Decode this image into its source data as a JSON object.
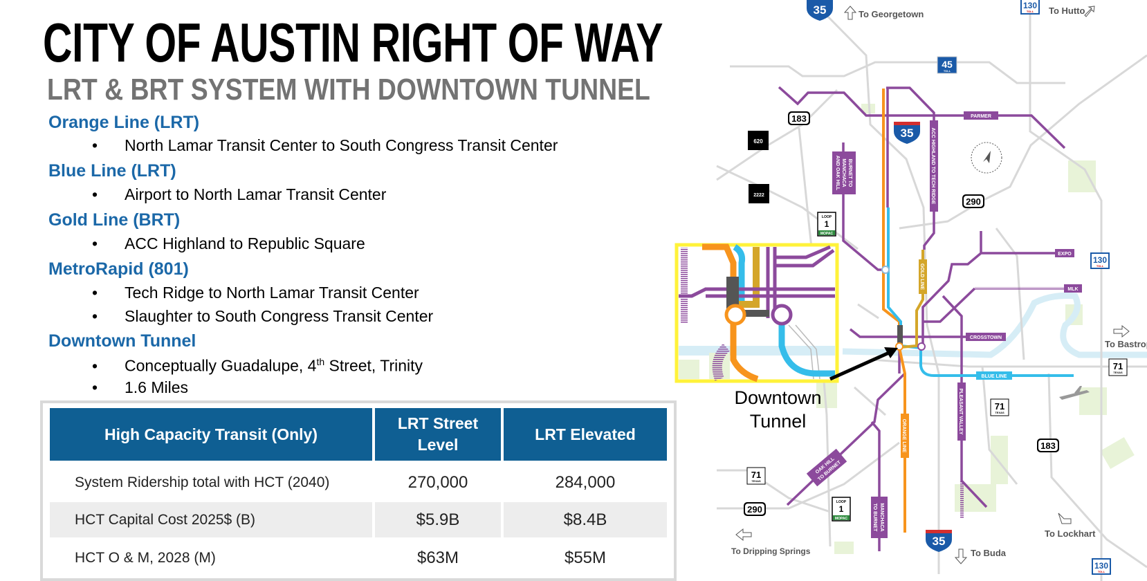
{
  "title": "CITY OF AUSTIN RIGHT OF WAY",
  "subtitle": "LRT & BRT SYSTEM WITH DOWNTOWN TUNNEL",
  "sections": [
    {
      "heading": "Orange Line (LRT)",
      "bullets": [
        "North Lamar Transit Center to South Congress Transit Center"
      ]
    },
    {
      "heading": "Blue Line (LRT)",
      "bullets": [
        "Airport to North Lamar Transit Center"
      ]
    },
    {
      "heading": "Gold Line (BRT)",
      "bullets": [
        "ACC Highland to Republic Square"
      ]
    },
    {
      "heading": "MetroRapid (801)",
      "bullets": [
        "Tech Ridge to North Lamar Transit Center",
        "Slaughter to South Congress Transit Center"
      ]
    },
    {
      "heading": "Downtown Tunnel",
      "bullets": [
        {
          "pre": "Conceptually Guadalupe, 4",
          "sup": "th",
          "post": " Street, Trinity"
        },
        "1.6 Miles"
      ]
    }
  ],
  "bullet_char": "•",
  "table": {
    "headers": [
      "High Capacity Transit (Only)",
      "LRT Street Level",
      "LRT Elevated"
    ],
    "rows": [
      [
        "System Ridership total with HCT (2040)",
        "270,000",
        "284,000"
      ],
      [
        "HCT Capital Cost 2025$ (B)",
        "$5.9B",
        "$8.4B"
      ],
      [
        "HCT O & M, 2028 (M)",
        "$63M",
        "$55M"
      ]
    ],
    "header_color": "#0f5f93",
    "stripe_color": "#ededed"
  },
  "map": {
    "callout": [
      "Downtown",
      "Tunnel"
    ],
    "destinations": [
      "To Georgetown",
      "To Hutto",
      "To Bastrop",
      "To Lockhart",
      "To Buda",
      "To Dripping Springs"
    ],
    "line_labels": {
      "parmer": "PARMER",
      "expo": "EXPO",
      "mlk": "MLK",
      "crosstown": "CROSSTOWN",
      "blue": "BLUE LINE",
      "orange": "ORANGE LINE",
      "gold": "GOLD LINE",
      "pleasant_valley": "PLEASANT VALLEY",
      "acc": "ACC HIGHLAND TO TECH RIDGE",
      "burnet": [
        "BURNET TO",
        "MANCHACA",
        "AND OAK HILL"
      ],
      "oak_hill": [
        "OAK HILL",
        "TO BURNET"
      ],
      "manchaca": [
        "MANCHACA",
        "TO BURNET"
      ]
    },
    "shields": {
      "i35": "35",
      "sh130": "130",
      "sh45": "45",
      "us183": "183",
      "rm620": "620",
      "rm2222": "2222",
      "loop1": "1",
      "loop": "LOOP",
      "mopac": "MOPAC",
      "us290": "290",
      "sh71": "71",
      "texas": "TEXAS",
      "toll": "TOLL"
    },
    "colors": {
      "orange": "#f7941d",
      "blue": "#35bdea",
      "gold": "#d4a62a",
      "purple": "#8c4a9c",
      "road": "#d6d6d6",
      "river": "#d6edf6",
      "park": "#e8f3d8",
      "inset_border": "#fff23a"
    }
  }
}
